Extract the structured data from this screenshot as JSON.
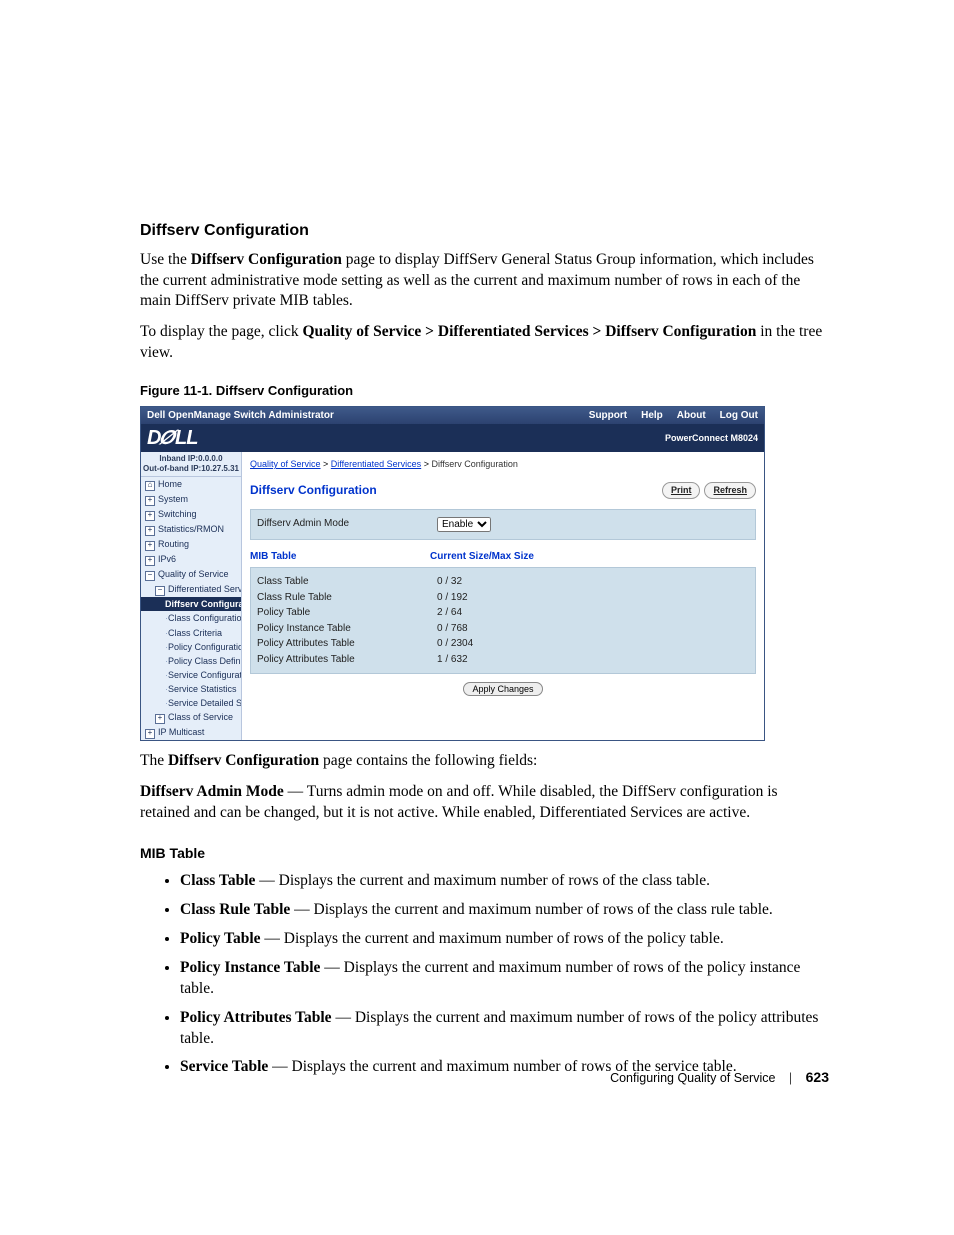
{
  "doc": {
    "section_title": "Diffserv Configuration",
    "intro_p1a": "Use the ",
    "intro_p1_bold": "Diffserv Configuration",
    "intro_p1b": " page to display DiffServ General Status Group information, which includes the current administrative mode setting as well as the current and maximum number of rows in each of the main DiffServ private MIB tables.",
    "intro_p2a": "To display the page, click ",
    "intro_p2_bold": "Quality of Service > Differentiated Services > Diffserv Configuration",
    "intro_p2b": " in the tree view.",
    "figure_caption": "Figure 11-1.    Diffserv Configuration",
    "post_fig_a": "The ",
    "post_fig_bold": "Diffserv Configuration",
    "post_fig_b": " page contains the following fields:",
    "admin_term": "Diffserv Admin Mode",
    "admin_desc": " — Turns admin mode on and off. While disabled, the DiffServ configuration is retained and can be changed, but it is not active. While enabled, Differentiated Services are active.",
    "mib_heading": "MIB Table",
    "bullets": [
      {
        "term": "Class Table",
        "desc": " — Displays the current and maximum number of rows of the class table."
      },
      {
        "term": "Class Rule Table",
        "desc": " — Displays the current and maximum number of rows of the class rule table."
      },
      {
        "term": "Policy Table",
        "desc": " — Displays the current and maximum number of rows of the policy table."
      },
      {
        "term": "Policy Instance Table",
        "desc": " — Displays the current and maximum number of rows of the policy instance table."
      },
      {
        "term": "Policy Attributes Table",
        "desc": " — Displays the current and maximum number of rows of the policy attributes table."
      },
      {
        "term": "Service Table",
        "desc": " — Displays the current and maximum number of rows of the service table."
      }
    ],
    "footer_text": "Configuring Quality of Service",
    "page_number": "623"
  },
  "ui": {
    "window_title": "Dell OpenManage Switch Administrator",
    "menu": {
      "support": "Support",
      "help": "Help",
      "about": "About",
      "logout": "Log Out"
    },
    "logo": "DELL",
    "model": "PowerConnect M8024",
    "ip1": "Inband IP:0.0.0.0",
    "ip2": "Out-of-band IP:10.27.5.31",
    "nav": {
      "home": "Home",
      "system": "System",
      "switching": "Switching",
      "stats": "Statistics/RMON",
      "routing": "Routing",
      "ipv6": "IPv6",
      "qos": "Quality of Service",
      "ds": "Differentiated Services",
      "diffserv_conf": "Diffserv Configura",
      "class_conf": "Class Configuration",
      "class_crit": "Class Criteria",
      "policy_conf": "Policy Configuration",
      "policy_class": "Policy Class Definit",
      "service_conf": "Service Configuratio",
      "service_stats": "Service Statistics",
      "service_det": "Service Detailed Sta",
      "cos": "Class of Service",
      "ipmc": "IP Multicast"
    },
    "breadcrumb": {
      "a": "Quality of Service",
      "b": "Differentiated Services",
      "c": "Diffserv Configuration"
    },
    "page_heading": "Diffserv Configuration",
    "print": "Print",
    "refresh": "Refresh",
    "admin_label": "Diffserv Admin Mode",
    "admin_value": "Enable",
    "mib_header": {
      "col1": "MIB Table",
      "col2": "Current Size/Max Size"
    },
    "mib_rows": [
      {
        "name": "Class Table",
        "val": "0 / 32"
      },
      {
        "name": "Class Rule Table",
        "val": "0 / 192"
      },
      {
        "name": "Policy Table",
        "val": "2 / 64"
      },
      {
        "name": "Policy Instance Table",
        "val": "0 / 768"
      },
      {
        "name": "Policy Attributes Table",
        "val": "0 / 2304"
      },
      {
        "name": "Policy Attributes Table",
        "val": "1 / 632"
      }
    ],
    "apply": "Apply Changes"
  }
}
